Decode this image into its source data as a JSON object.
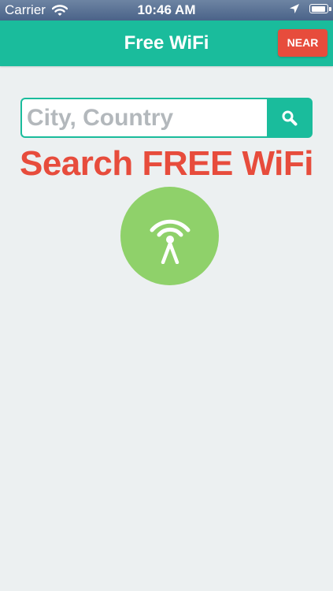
{
  "status_bar": {
    "carrier": "Carrier",
    "time": "10:46 AM",
    "icons": [
      "wifi-signal-icon",
      "location-arrow-icon",
      "battery-icon"
    ],
    "battery_level": 0.9
  },
  "nav_bar": {
    "title": "Free WiFi",
    "near_label": "NEAR",
    "background_color": "#1abc9c",
    "near_button_color": "#e74c3c"
  },
  "search": {
    "placeholder": "City, Country",
    "value": "",
    "button_icon": "search-icon"
  },
  "main": {
    "headline": "Search FREE WiFi",
    "headline_color": "#e74c3c",
    "logo_icon": "wifi-antenna-icon",
    "logo_color": "#8fd16a"
  },
  "colors": {
    "background": "#ecf0f1",
    "accent": "#1abc9c"
  }
}
